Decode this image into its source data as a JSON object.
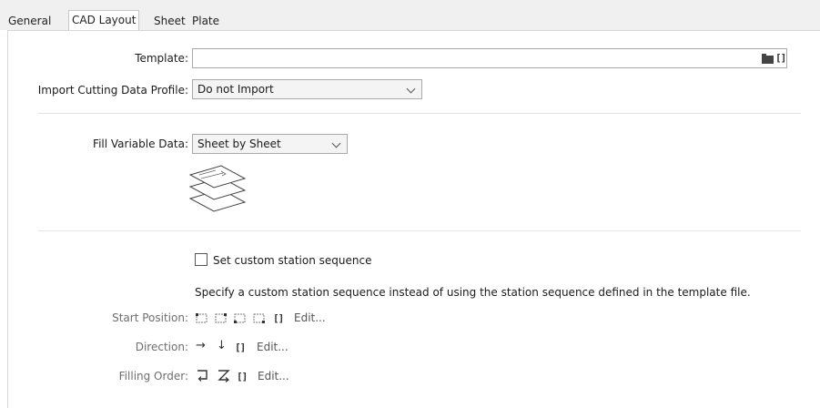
{
  "tabs": [
    "General",
    "CAD Layout",
    "Sheet",
    "Plate"
  ],
  "template": {
    "label": "Template:",
    "value": "",
    "browse_icon": "folder-icon",
    "variables_icon": "brackets-icon",
    "variables_text": "[]"
  },
  "import_profile": {
    "label": "Import Cutting Data Profile:",
    "value": "Do not Import"
  },
  "fill_variable": {
    "label": "Fill Variable Data:",
    "value": "Sheet by Sheet",
    "illustration_icon": "stacked-sheets-icon"
  },
  "custom_sequence": {
    "checkbox_label": "Set custom station sequence",
    "checked": false,
    "description": "Specify a custom station sequence instead of using the station sequence defined in the template file."
  },
  "start_position": {
    "label": "Start Position:",
    "options": [
      "top-left-corner-icon",
      "top-right-corner-icon",
      "bottom-left-corner-icon",
      "bottom-right-corner-icon"
    ],
    "variables_text": "[]",
    "edit_label": "Edit..."
  },
  "direction": {
    "label": "Direction:",
    "horizontal_glyph": "→",
    "vertical_glyph": "↓",
    "variables_text": "[]",
    "edit_label": "Edit..."
  },
  "filling_order": {
    "label": "Filling Order:",
    "options": [
      "snake-order-icon",
      "z-order-icon"
    ],
    "variables_text": "[]",
    "edit_label": "Edit..."
  }
}
